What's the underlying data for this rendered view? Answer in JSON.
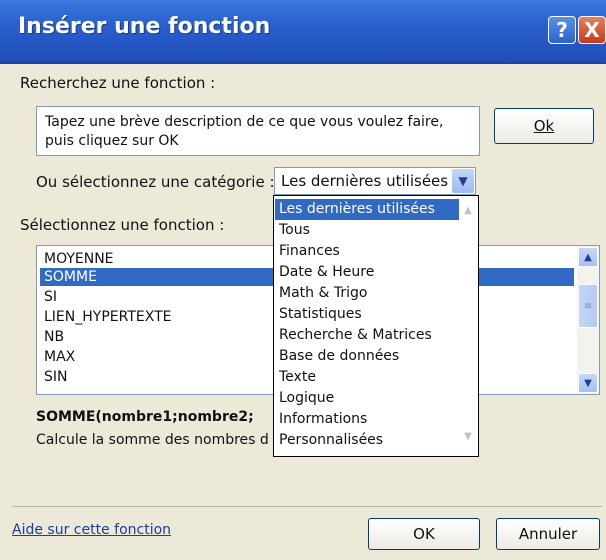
{
  "window": {
    "title": "Insérer une fonction",
    "help_glyph": "?",
    "close_glyph": "X"
  },
  "search": {
    "label": "Recherchez une fonction :",
    "description": "Tapez une brève description de ce que vous voulez faire, puis cliquez sur OK",
    "ok_button": "Ok"
  },
  "category": {
    "label": "Ou sélectionnez une catégorie :",
    "selected": "Les dernières utilisées",
    "options": [
      "Les dernières utilisées",
      "Tous",
      "Finances",
      "Date & Heure",
      "Math & Trigo",
      "Statistiques",
      "Recherche & Matrices",
      "Base de données",
      "Texte",
      "Logique",
      "Informations",
      "Personnalisées"
    ]
  },
  "functions": {
    "label": "Sélectionnez une fonction :",
    "items": [
      "MOYENNE",
      "SOMME",
      "SI",
      "LIEN_HYPERTEXTE",
      "NB",
      "MAX",
      "SIN"
    ],
    "selected": "SOMME",
    "signature": "SOMME(nombre1;nombre2;",
    "description": "Calcule la somme des nombres d"
  },
  "footer": {
    "help_link": "Aide sur cette fonction",
    "ok_button": "OK",
    "cancel_button": "Annuler"
  },
  "colors": {
    "title_bar": "#2a5fcd",
    "selection": "#316ac5",
    "dialog_bg": "#ece9d8"
  }
}
